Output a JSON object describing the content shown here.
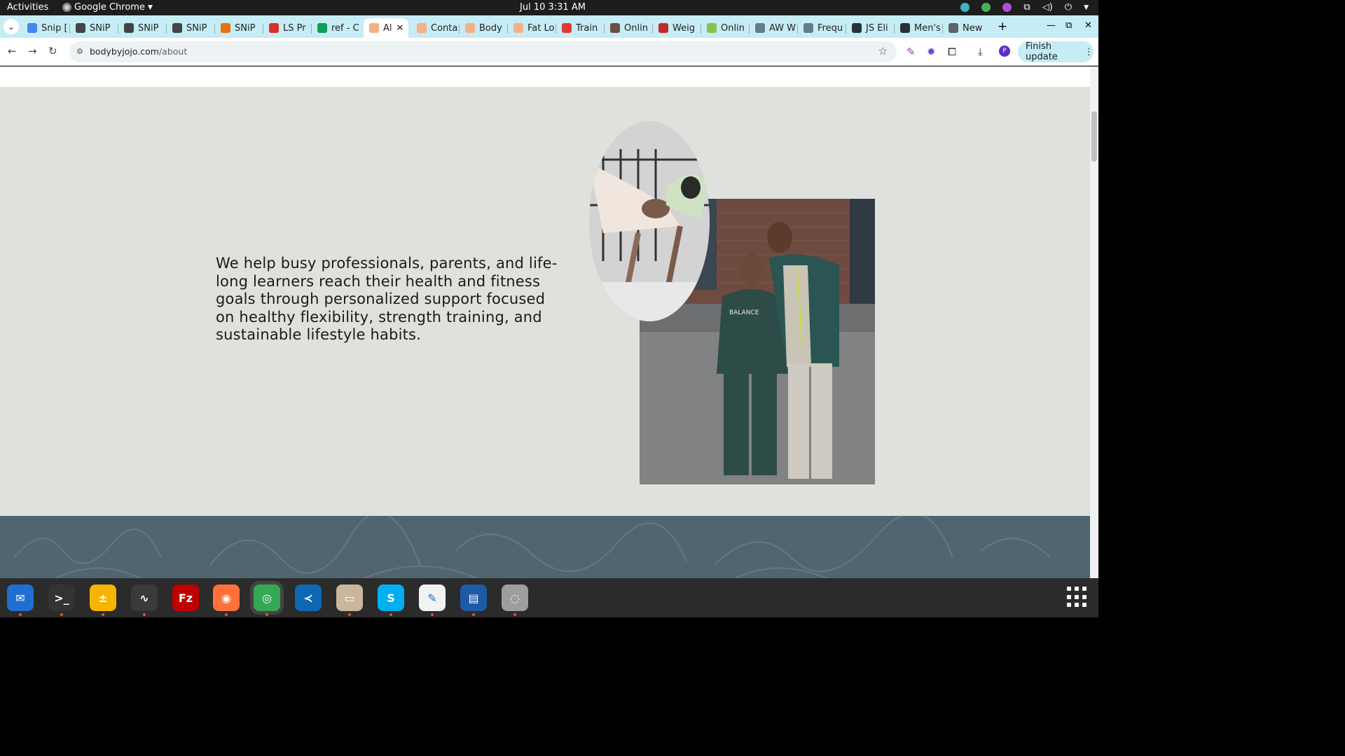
{
  "topbar": {
    "activities": "Activities",
    "app_name": "Google Chrome",
    "clock": "Jul 10  3:31 AM"
  },
  "tabs": [
    {
      "label": "Snip [",
      "color": "#4285f4"
    },
    {
      "label": "SNiP",
      "color": "#444444"
    },
    {
      "label": "SNiP",
      "color": "#444444"
    },
    {
      "label": "SNiP",
      "color": "#444444"
    },
    {
      "label": "SNiP",
      "color": "#e8710a"
    },
    {
      "label": "LS Pr",
      "color": "#d93025"
    },
    {
      "label": "ref - C",
      "color": "#0f9d58"
    },
    {
      "label": "Al",
      "color": "#f4b183",
      "active": true
    },
    {
      "label": "Conta",
      "color": "#f4b183"
    },
    {
      "label": "Body",
      "color": "#f4b183"
    },
    {
      "label": "Fat Lo",
      "color": "#f4b183"
    },
    {
      "label": "Train",
      "color": "#e53935"
    },
    {
      "label": "Onlin",
      "color": "#6d4c41"
    },
    {
      "label": "Weig",
      "color": "#c62828"
    },
    {
      "label": "Onlin",
      "color": "#8bc34a"
    },
    {
      "label": "AW W",
      "color": "#607d8b"
    },
    {
      "label": "Frequ",
      "color": "#607d8b"
    },
    {
      "label": "JS Eli",
      "color": "#263238"
    },
    {
      "label": "Men's",
      "color": "#263238"
    },
    {
      "label": "New",
      "color": "#5f6368"
    }
  ],
  "toolbar": {
    "url_domain": "bodybyjojo.com",
    "url_path": "/about",
    "finish_update": "Finish update",
    "profile_initial": "P"
  },
  "page": {
    "about_text": "We help busy professionals, parents, and life-long learners reach their health and fitness goals through personalized support focused on healthy flexibility, strength training, and sustainable lifestyle habits.",
    "sweatshirt_text": "BALANCE"
  },
  "colors": {
    "section_bg": "#dfe1dc",
    "next_section_bg": "#4f6670",
    "tabstrip_bg": "#c6ecf5"
  },
  "dock": [
    {
      "name": "thunderbird-icon",
      "color": "#1f6fd0",
      "glyph": "✉"
    },
    {
      "name": "terminal-icon",
      "color": "#333333",
      "glyph": ">_"
    },
    {
      "name": "notes-icon",
      "color": "#f5b400",
      "glyph": "±"
    },
    {
      "name": "system-monitor-icon",
      "color": "#3a3a3a",
      "glyph": "∿"
    },
    {
      "name": "filezilla-icon",
      "color": "#bf0000",
      "glyph": "Fz"
    },
    {
      "name": "firefox-icon",
      "color": "#ff7139",
      "glyph": "◉"
    },
    {
      "name": "chrome-icon",
      "color": "#34a853",
      "glyph": "◎"
    },
    {
      "name": "vscode-icon",
      "color": "#0e67b4",
      "glyph": "≺"
    },
    {
      "name": "files-icon",
      "color": "#c9b79c",
      "glyph": "▭"
    },
    {
      "name": "skype-icon",
      "color": "#00aff0",
      "glyph": "S"
    },
    {
      "name": "text-editor-icon",
      "color": "#f2f2f2",
      "glyph": "✎"
    },
    {
      "name": "document-viewer-icon",
      "color": "#1e5aa8",
      "glyph": "▤"
    },
    {
      "name": "disk-utility-icon",
      "color": "#9e9e9e",
      "glyph": "◌"
    }
  ]
}
